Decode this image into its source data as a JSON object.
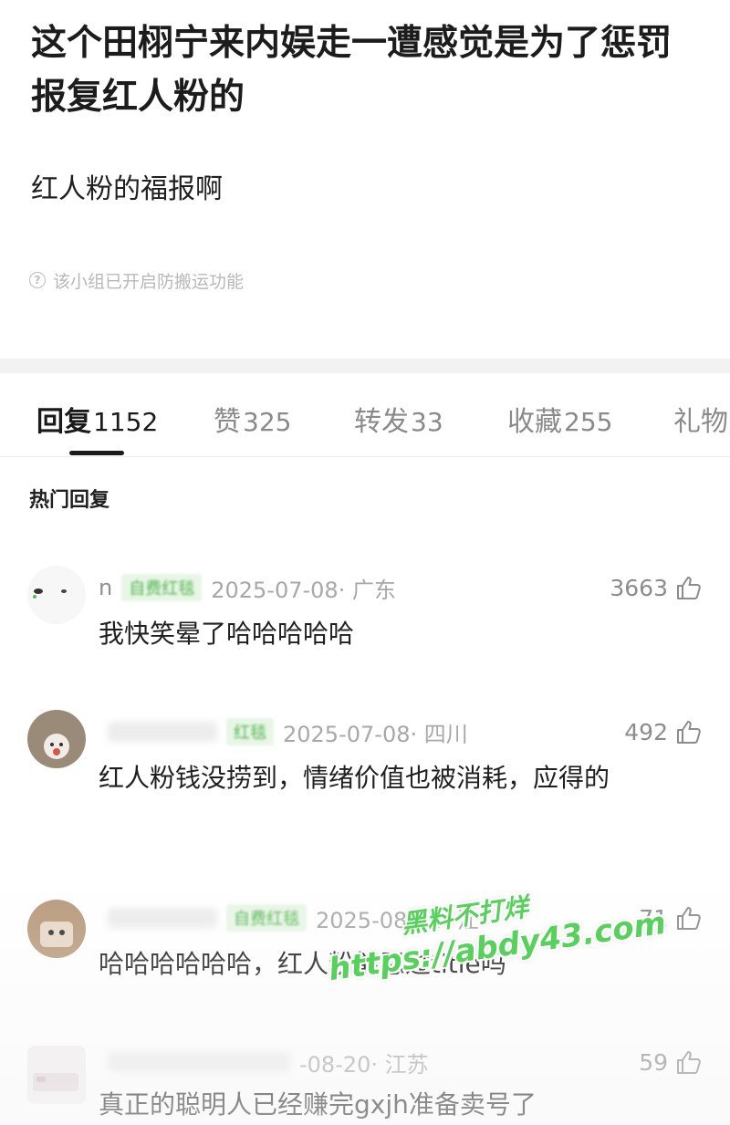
{
  "post": {
    "title": "这个田栩宁来内娱走一遭感觉是为了惩罚报复红人粉的",
    "body": "红人粉的福报啊",
    "notice": "该小组已开启防搬运功能",
    "notice_icon": "question-circle-icon"
  },
  "tabs": [
    {
      "label": "回复",
      "count": "1152",
      "active": true
    },
    {
      "label": "赞",
      "count": "325",
      "active": false
    },
    {
      "label": "转发",
      "count": "33",
      "active": false
    },
    {
      "label": "收藏",
      "count": "255",
      "active": false
    },
    {
      "label": "礼物",
      "count": "",
      "active": false
    }
  ],
  "hot_heading": "热门回复",
  "comments": [
    {
      "user": "n",
      "badge": "自费红毯",
      "time_location": "2025-07-08· 广东",
      "likes": "3663",
      "text": "我快笑晕了哈哈哈哈哈"
    },
    {
      "user": "",
      "badge": "红毯",
      "time_location": "2025-07-08· 四川",
      "likes": "492",
      "text": "红人粉钱没捞到，情绪价值也被消耗，应得的"
    },
    {
      "user": "",
      "badge": "自费红毯",
      "time_location": "2025-08-20· 江",
      "likes": "71",
      "text": "哈哈哈哈哈哈，红人粉能忍过title吗"
    },
    {
      "user": "",
      "badge": "",
      "time_location": "-08-20· 江苏",
      "likes": "59",
      "text": "真正的聪明人已经赚完gxjh准备卖号了"
    }
  ],
  "watermark": {
    "line1": "黑料不打烊",
    "line2": "https://abdy43.com"
  },
  "colors": {
    "badge_green": "#53b34f",
    "watermark_green": "#58d05c",
    "meta_gray": "#a8a8a8"
  },
  "icons": {
    "like": "thumbs-up-icon"
  }
}
